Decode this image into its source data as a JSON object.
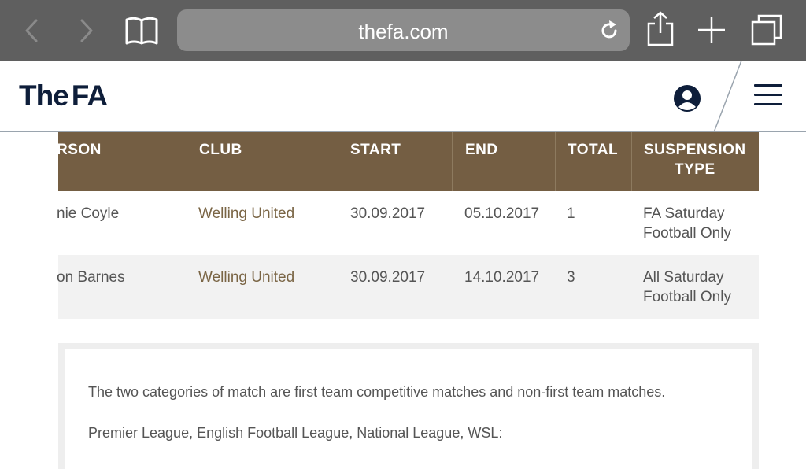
{
  "browser": {
    "url": "thefa.com"
  },
  "site": {
    "logo_the": "The",
    "logo_fa": "FA"
  },
  "table": {
    "headers": [
      "RSON",
      "CLUB",
      "START",
      "END",
      "TOTAL",
      "SUSPENSION",
      "TYPE"
    ],
    "rows": [
      {
        "person": "nie Coyle",
        "club": "Welling United",
        "start": "30.09.2017",
        "end": "05.10.2017",
        "total": "1",
        "type_line1": "FA Saturday",
        "type_line2": "Football Only"
      },
      {
        "person": "on Barnes",
        "club": "Welling United",
        "start": "30.09.2017",
        "end": "14.10.2017",
        "total": "3",
        "type_line1": "All Saturday",
        "type_line2": "Football Only"
      }
    ]
  },
  "info": {
    "para1": "The two categories of match are first team competitive matches and non-first team matches.",
    "para2": "Premier League, English Football League, National League, WSL:"
  },
  "colors": {
    "header_bg": "#745e43",
    "club_link": "#7a6545",
    "brand_navy": "#0e1e3a"
  }
}
